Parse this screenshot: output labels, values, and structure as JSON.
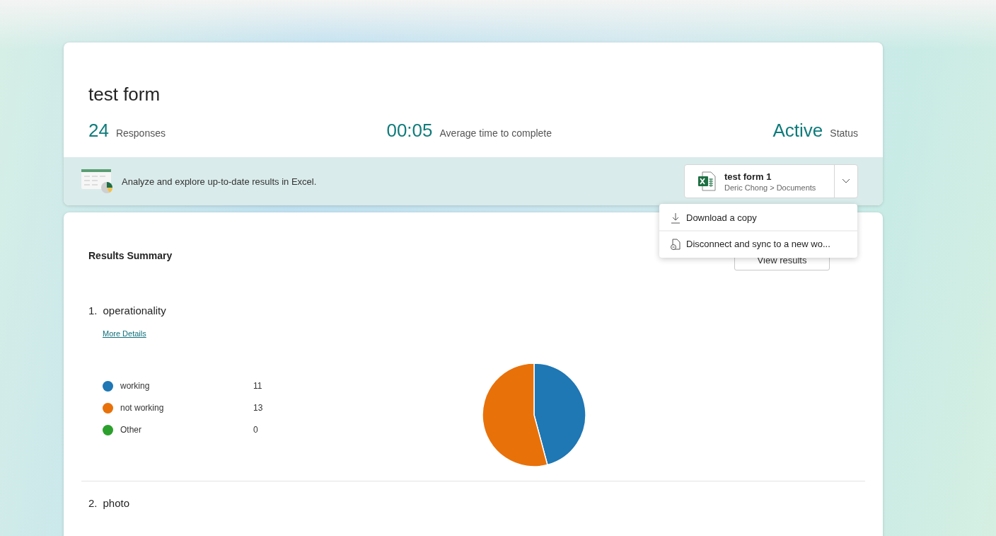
{
  "form": {
    "title": "test form",
    "stats": [
      {
        "value": "24",
        "label": "Responses"
      },
      {
        "value": "00:05",
        "label": "Average time to complete"
      },
      {
        "value": "Active",
        "label": "Status"
      }
    ]
  },
  "excel_bar": {
    "message": "Analyze and explore up-to-date results in Excel.",
    "workbook": {
      "name": "test form 1",
      "path": "Deric Chong > Documents"
    }
  },
  "workbook_menu": {
    "items": [
      {
        "kind": "download",
        "label": "Download a copy"
      },
      {
        "kind": "disconnect",
        "label": "Disconnect and sync to a new wo..."
      }
    ]
  },
  "results": {
    "title": "Results Summary",
    "view_button": "View results",
    "questions": [
      {
        "number": "1.",
        "title": "operationality",
        "link": "More Details",
        "options": [
          {
            "color": "#1f77b4"
          },
          {
            "color": "#e8710a"
          },
          {
            "color": "#2ca02c"
          }
        ],
        "chart_data": {
          "type": "pie",
          "categories": [
            "working",
            "not working",
            "Other"
          ],
          "values": [
            11,
            13,
            0
          ],
          "value_labels": [
            "11",
            "13",
            "0"
          ],
          "legend": "left"
        }
      },
      {
        "number": "2.",
        "title": "photo"
      }
    ]
  }
}
